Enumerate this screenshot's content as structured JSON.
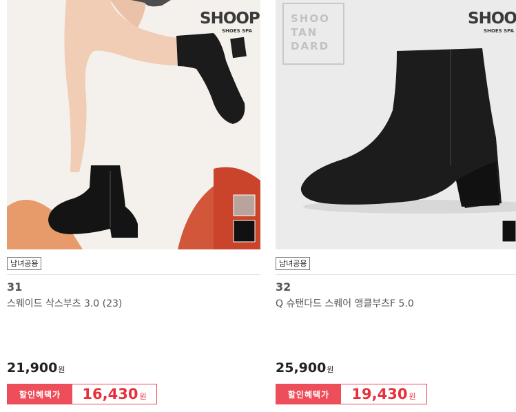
{
  "products": [
    {
      "brand_logo": "SHOOPEN",
      "brand_sub": "SHOES SPA",
      "badge": "남녀공용",
      "number": "31",
      "name": "스웨이드 삭스부츠 3.0 (23)",
      "price": "21,900",
      "currency": "원",
      "sale_label": "할인혜택가",
      "sale_price": "16,430",
      "swatches": [
        "#b9a49b",
        "#111111"
      ]
    },
    {
      "brand_logo": "SHOOPE",
      "brand_sub": "SHOES SPA",
      "stamp_lines": [
        "SHOO",
        "TAN",
        "DARD"
      ],
      "badge": "남녀공용",
      "number": "32",
      "name": "Q 슈탠다드 스퀘어 앵클부츠F 5.0",
      "price": "25,900",
      "currency": "원",
      "sale_label": "할인혜택가",
      "sale_price": "19,430",
      "swatches": [
        "#111111"
      ]
    }
  ],
  "colors": {
    "accent": "#ee4e5a",
    "sale_text": "#e8303d"
  }
}
